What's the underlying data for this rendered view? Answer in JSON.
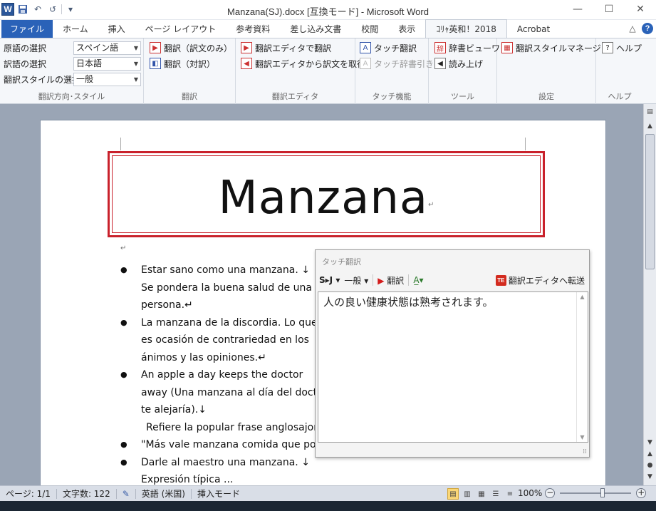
{
  "window": {
    "title": "Manzana(SJ).docx [互換モード] - Microsoft Word",
    "app_icon": "W",
    "controls": {
      "minimize": "—",
      "maximize": "☐",
      "close": "✕"
    }
  },
  "qat": {
    "undo": "↶",
    "redo": "↺",
    "customize": "▾"
  },
  "tabs": [
    "ファイル",
    "ホーム",
    "挿入",
    "ページ レイアウト",
    "参考資料",
    "差し込み文書",
    "校閲",
    "表示",
    "ｺﾘｬ英和！2018",
    "Acrobat"
  ],
  "tab_right": {
    "collapse": "△",
    "help": "?"
  },
  "ribbon": {
    "direction_group": {
      "label": "翻訳方向･スタイル",
      "source_label": "原語の選択",
      "source_value": "スペイン語",
      "target_label": "訳語の選択",
      "target_value": "日本語",
      "style_label": "翻訳スタイルの選択",
      "style_value": "一般"
    },
    "translate_group": {
      "label": "翻訳",
      "item1": "翻訳（訳文のみ）",
      "item2": "翻訳（対訳）"
    },
    "editor_group": {
      "label": "翻訳エディタ",
      "item1": "翻訳エディタで翻訳",
      "item2": "翻訳エディタから訳文を取得"
    },
    "touch_group": {
      "label": "タッチ機能",
      "item1": "タッチ翻訳",
      "item2": "タッチ辞書引き"
    },
    "tools_group": {
      "label": "ツール",
      "item1": "辞書ビューワ",
      "item2": "読み上げ"
    },
    "settings_group": {
      "label": "設定",
      "item1": "翻訳スタイルマネージャ"
    },
    "help_group": {
      "label": "ヘルプ",
      "item1": "ヘルプ"
    }
  },
  "document": {
    "title": "Manzana",
    "para_mark": "↵",
    "line_break": "↓",
    "lines": [
      "Estar sano como una manzana. ↓",
      "Se pondera la buena salud de una",
      "persona.↵",
      "La manzana de la discordia. Lo que",
      "es ocasión de contrariedad en los",
      "ánimos y las opiniones.↵",
      "An apple a day keeps the doctor",
      "away (Una manzana al día del doctor",
      "te alejaría).↓",
      "Refiere la popular frase anglosajon",
      "\"Más vale manzana comida que pod",
      "Darle al maestro una manzana. ↓",
      "Expresión típica ..."
    ]
  },
  "touch_panel": {
    "title": "タッチ翻訳",
    "direction": "S▸J",
    "style": "一般",
    "translate_button": "翻訳",
    "transfer_button": "翻訳エディタへ転送",
    "result": "人の良い健康状態は熟考されます。"
  },
  "statusbar": {
    "page": "ページ: 1/1",
    "word_count": "文字数: 122",
    "language": "英語 (米国)",
    "insert_mode": "挿入モード",
    "zoom": "100%",
    "zoom_percent": 100
  }
}
